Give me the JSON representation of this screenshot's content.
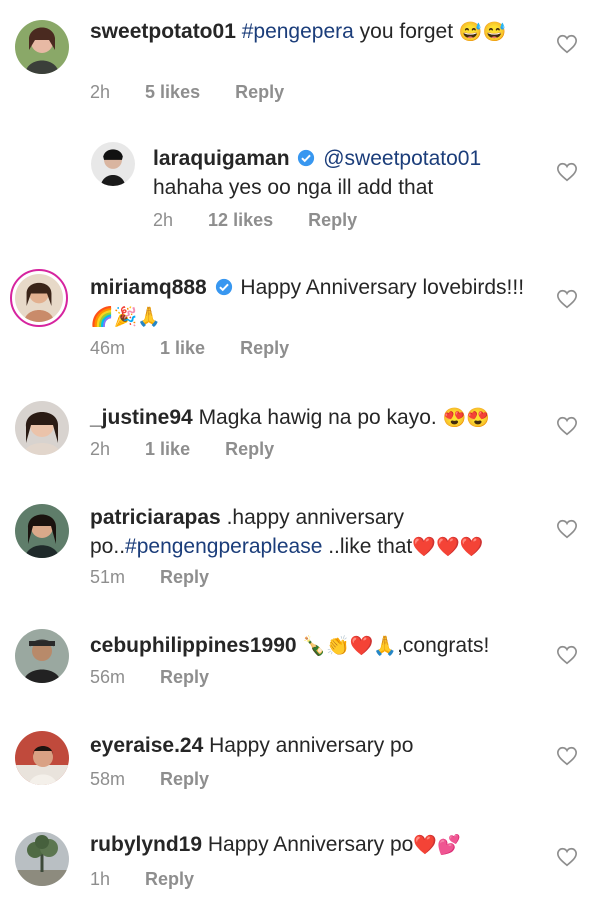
{
  "comments": [
    {
      "user": "sweetpotato01",
      "tag": "#pengepera",
      "body": " you forget ",
      "emoji": "😅😅",
      "time": "2h",
      "likes": "5 likes",
      "reply": "Reply"
    },
    {
      "user": "laraquigaman",
      "mention": "@sweetpotato01",
      "body": "hahaha yes oo nga ill add that",
      "time": "2h",
      "likes": "12 likes",
      "reply": "Reply",
      "verified": true
    },
    {
      "user": "miriamq888",
      "body": "Happy Anniversary lovebirds!!!",
      "emoji": "🌈🎉🙏",
      "time": "46m",
      "likes": "1 like",
      "reply": "Reply",
      "verified": true
    },
    {
      "user": "_justine94",
      "body": "Magka hawig na po kayo. ",
      "emoji": "😍😍",
      "time": "2h",
      "likes": "1 like",
      "reply": "Reply"
    },
    {
      "user": "patriciarapas",
      "body": ".happy anniversary po..",
      "tag": "#pengengperaplease",
      "body2": " ..like that",
      "emoji": "❤️❤️❤️",
      "time": "51m",
      "reply": "Reply"
    },
    {
      "user": "cebuphilippines1990",
      "emoji": "🍾👏❤️🙏",
      "body": ",congrats!",
      "time": "56m",
      "reply": "Reply"
    },
    {
      "user": "eyeraise.24",
      "body": "Happy anniversary po",
      "time": "58m",
      "reply": "Reply"
    },
    {
      "user": "rubylynd19",
      "body": "Happy Anniversary po",
      "emoji": "❤️💕",
      "time": "1h",
      "reply": "Reply"
    }
  ],
  "icons": {
    "like": "heart-outline-icon",
    "verified": "verified-badge-icon"
  },
  "colors": {
    "link": "#1b3d7a",
    "meta": "#8e8e8e",
    "verified": "#3897f0",
    "ring": "#d6249f"
  }
}
